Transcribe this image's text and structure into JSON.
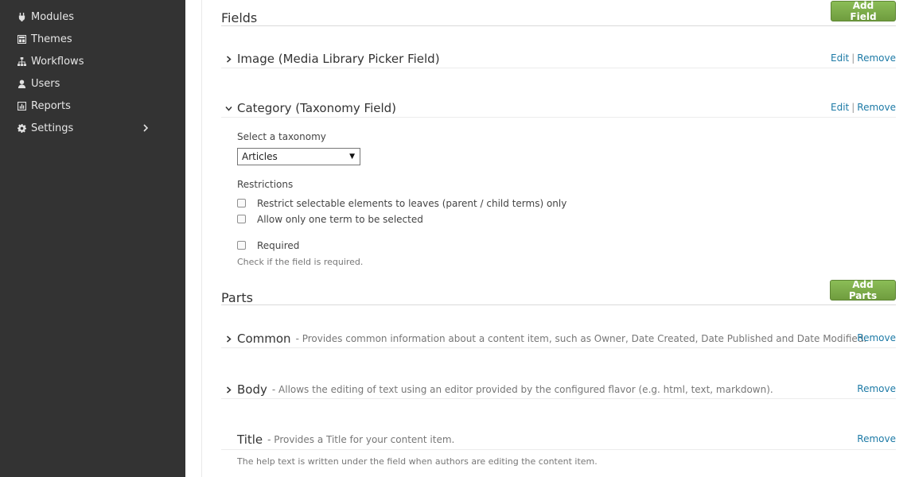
{
  "sidebar": {
    "items": [
      {
        "label": "Modules",
        "icon": "plug-icon"
      },
      {
        "label": "Themes",
        "icon": "themes-icon"
      },
      {
        "label": "Workflows",
        "icon": "workflow-icon"
      },
      {
        "label": "Users",
        "icon": "user-icon"
      },
      {
        "label": "Reports",
        "icon": "reports-icon"
      },
      {
        "label": "Settings",
        "icon": "gear-icon",
        "has_submenu": true
      }
    ]
  },
  "fields": {
    "title": "Fields",
    "add_button": "Add Field",
    "items": [
      {
        "name": "Image (Media Library Picker Field)",
        "edit": "Edit",
        "remove": "Remove",
        "expanded": false
      },
      {
        "name": "Category (Taxonomy Field)",
        "edit": "Edit",
        "remove": "Remove",
        "expanded": true
      }
    ],
    "taxonomy": {
      "label": "Select a taxonomy",
      "selected": "Articles",
      "restrictions_label": "Restrictions",
      "leaves_only": "Restrict selectable elements to leaves (parent / child terms) only",
      "single_choice": "Allow only one term to be selected",
      "required": "Required",
      "required_help": "Check if the field is required."
    }
  },
  "parts": {
    "title": "Parts",
    "add_button": "Add Parts",
    "items": [
      {
        "name": "Common",
        "description": "- Provides common information about a content item, such as Owner, Date Created, Date Published and Date Modified.",
        "remove": "Remove"
      },
      {
        "name": "Body",
        "description": "- Allows the editing of text using an editor provided by the configured flavor (e.g. html, text, markdown).",
        "remove": "Remove"
      },
      {
        "name": "Title",
        "description": "- Provides a Title for your content item.",
        "remove": "Remove",
        "help": "The help text is written under the field when authors are editing the content item."
      }
    ]
  },
  "colors": {
    "sidebar": "#333333",
    "accent_green": "#7aa84a",
    "link": "#1d7aa6"
  }
}
